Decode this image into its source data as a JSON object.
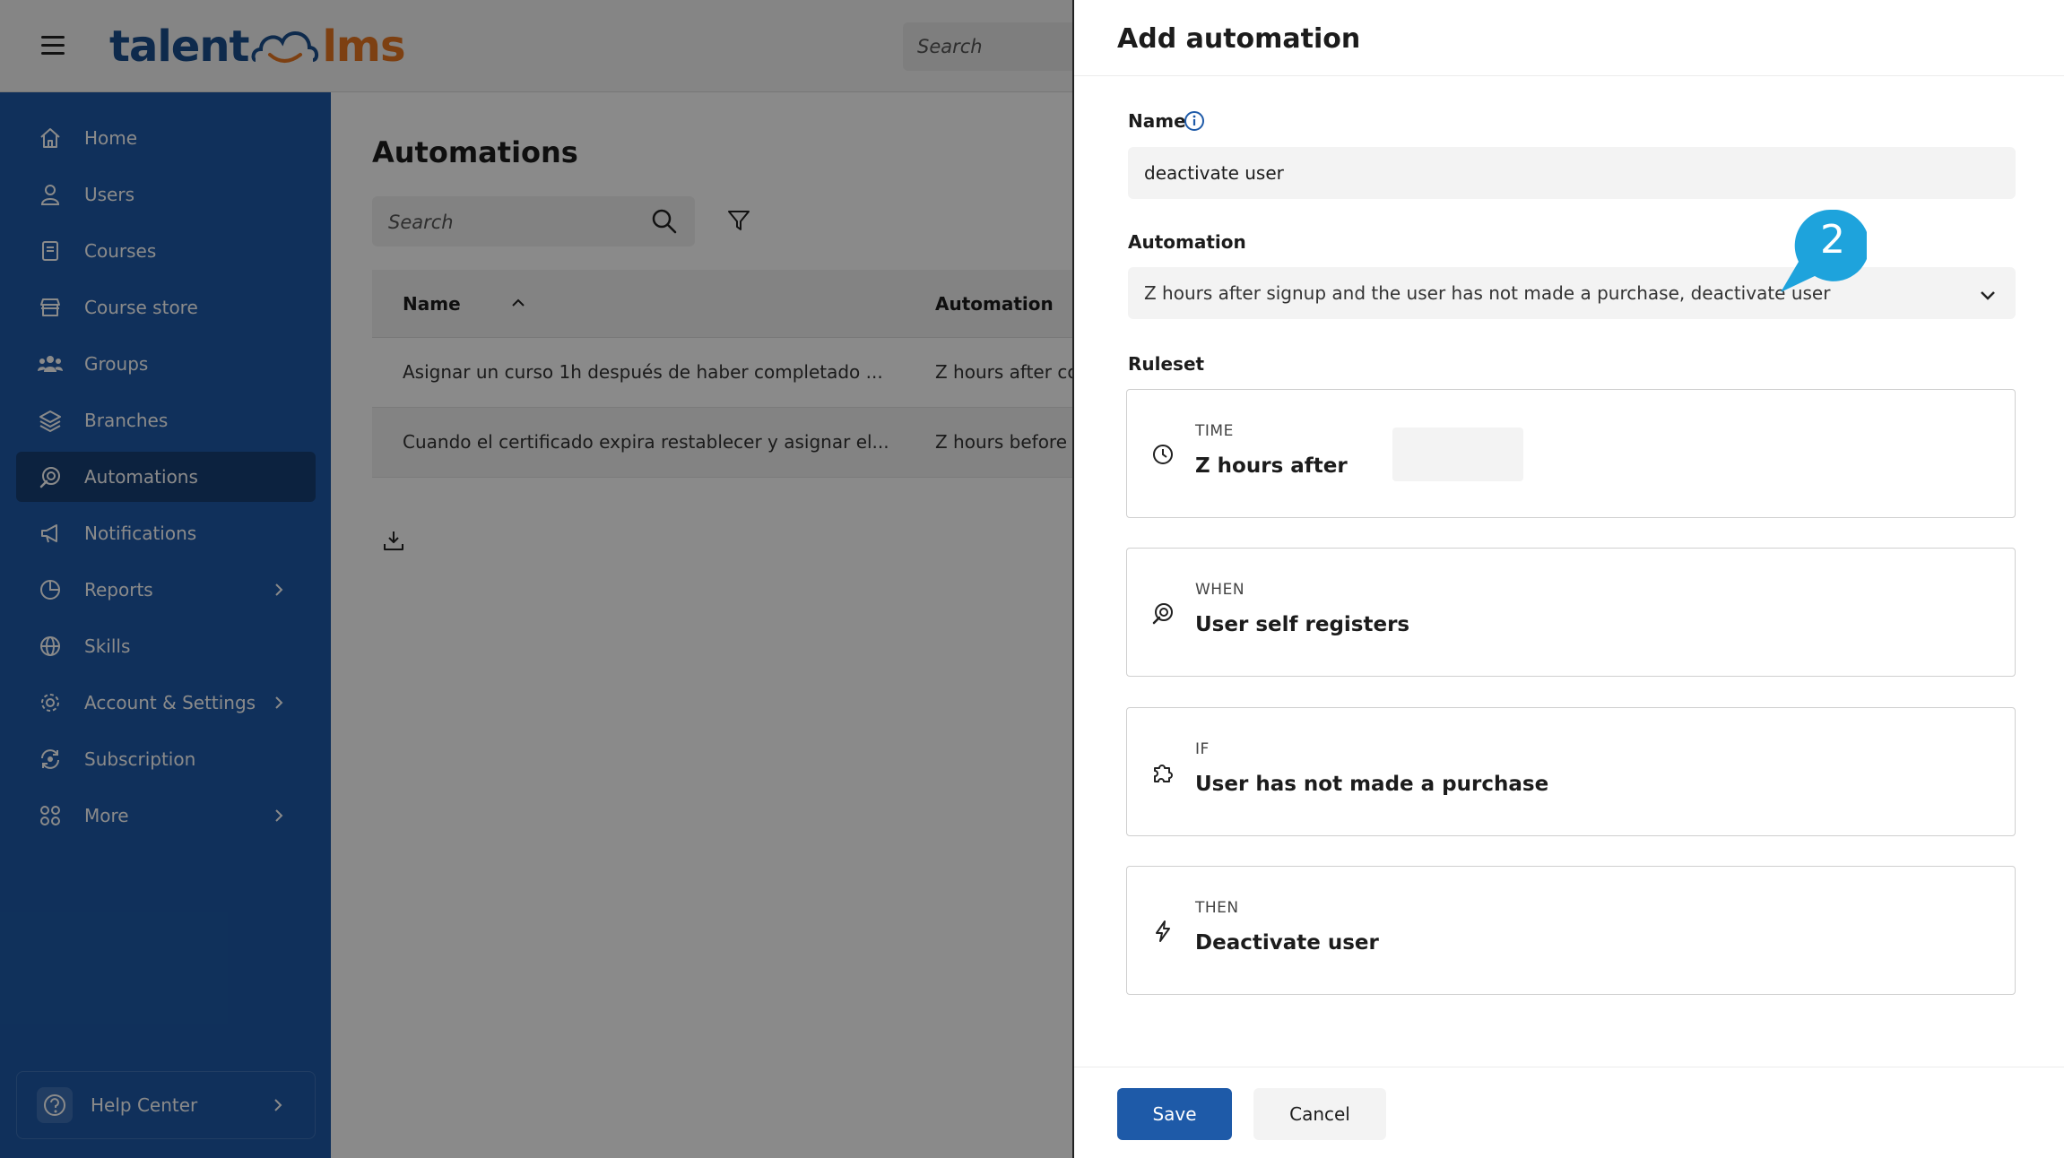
{
  "app": {
    "logo_part1": "talent",
    "logo_part2": "lms",
    "search_placeholder": "Search"
  },
  "sidebar": {
    "items": [
      {
        "label": "Home",
        "icon": "home-icon"
      },
      {
        "label": "Users",
        "icon": "user-icon"
      },
      {
        "label": "Courses",
        "icon": "book-icon"
      },
      {
        "label": "Course store",
        "icon": "store-icon"
      },
      {
        "label": "Groups",
        "icon": "groups-icon"
      },
      {
        "label": "Branches",
        "icon": "layers-icon"
      },
      {
        "label": "Automations",
        "icon": "automation-icon",
        "active": true
      },
      {
        "label": "Notifications",
        "icon": "megaphone-icon"
      },
      {
        "label": "Reports",
        "icon": "pie-chart-icon",
        "has_children": true
      },
      {
        "label": "Skills",
        "icon": "globe-icon"
      },
      {
        "label": "Account & Settings",
        "icon": "gear-icon",
        "has_children": true
      },
      {
        "label": "Subscription",
        "icon": "refresh-dollar-icon"
      },
      {
        "label": "More",
        "icon": "grid-icon",
        "has_children": true
      }
    ],
    "help": "Help Center"
  },
  "main": {
    "title": "Automations",
    "search_placeholder": "Search",
    "table": {
      "headers": [
        "Name",
        "Automation"
      ],
      "rows": [
        [
          "Asignar un curso 1h después de haber completado ...",
          "Z hours after co"
        ],
        [
          "Cuando el certificado expira restablecer y asignar el...",
          "Z hours before c"
        ]
      ]
    }
  },
  "drawer": {
    "title": "Add automation",
    "name_label": "Name",
    "name_value": "deactivate user",
    "automation_label": "Automation",
    "automation_value": "Z hours after signup and the user has not made a purchase, deactivate user",
    "ruleset_label": "Ruleset",
    "callout_number": "2",
    "rules": [
      {
        "kind": "TIME",
        "value": "Z hours after",
        "icon": "clock-icon"
      },
      {
        "kind": "WHEN",
        "value": "User self registers",
        "icon": "automation-icon"
      },
      {
        "kind": "IF",
        "value": "User has not made a purchase",
        "icon": "puzzle-icon"
      },
      {
        "kind": "THEN",
        "value": "Deactivate user",
        "icon": "lightning-icon"
      }
    ],
    "save_label": "Save",
    "cancel_label": "Cancel"
  },
  "colors": {
    "sidebar_bg": "#1e5aa8",
    "sidebar_active": "#173f75",
    "primary_button": "#1e5aa8",
    "callout": "#1ea3dc",
    "logo_blue": "#1b4e8c",
    "logo_orange": "#e87722"
  }
}
